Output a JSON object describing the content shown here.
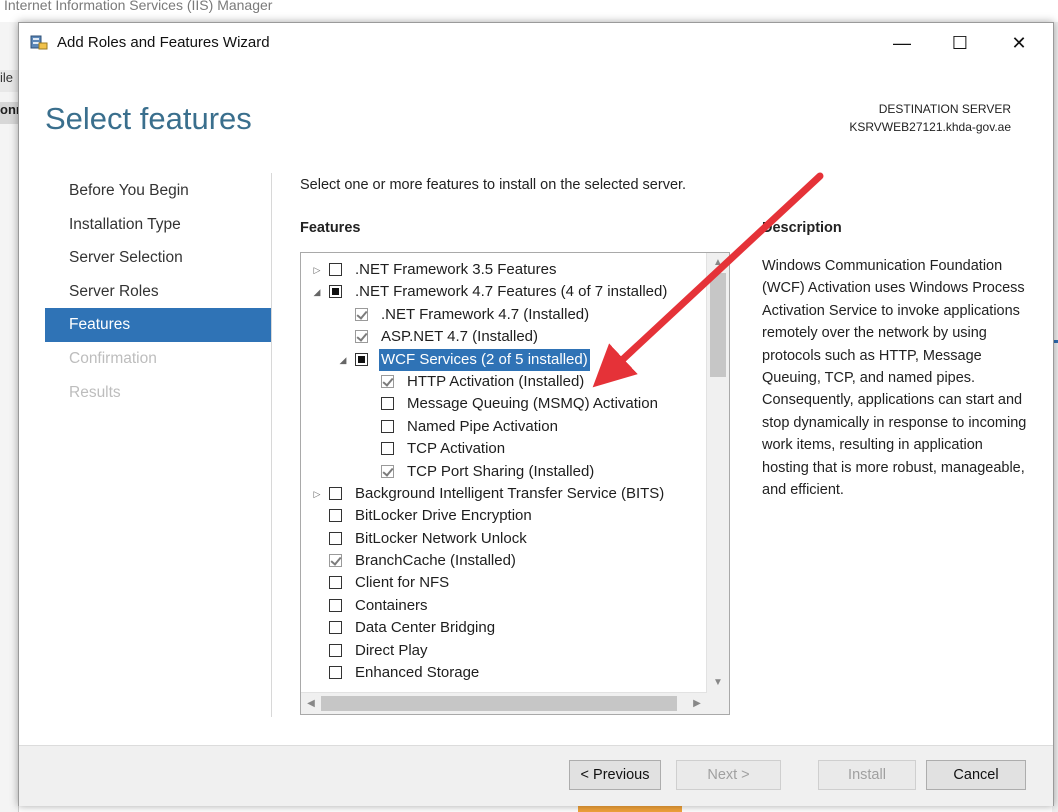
{
  "background_window": {
    "title": "Internet Information Services (IIS) Manager",
    "left_fragments": [
      "ile",
      "onn"
    ]
  },
  "dialog": {
    "title": "Add Roles and Features Wizard",
    "controls": {
      "minimize": "—",
      "maximize": "☐",
      "close": "✕"
    },
    "heading": "Select features",
    "destination_label": "DESTINATION SERVER",
    "destination_server": "KSRVWEB27121.khda-gov.ae"
  },
  "nav": {
    "items": [
      {
        "label": "Before You Begin",
        "state": "normal"
      },
      {
        "label": "Installation Type",
        "state": "normal"
      },
      {
        "label": "Server Selection",
        "state": "normal"
      },
      {
        "label": "Server Roles",
        "state": "normal"
      },
      {
        "label": "Features",
        "state": "active"
      },
      {
        "label": "Confirmation",
        "state": "disabled"
      },
      {
        "label": "Results",
        "state": "disabled"
      }
    ]
  },
  "content": {
    "intro": "Select one or more features to install on the selected server.",
    "features_label": "Features",
    "description_label": "Description",
    "description_text": "Windows Communication Foundation (WCF) Activation uses Windows Process Activation Service to invoke applications remotely over the network by using protocols such as HTTP, Message Queuing, TCP, and named pipes. Consequently, applications can start and stop dynamically in response to incoming work items, resulting in application hosting that is more robust, manageable, and efficient."
  },
  "features": [
    {
      "label": ".NET Framework 3.5 Features",
      "level": 0,
      "expander": "collapsed",
      "state": "unchecked"
    },
    {
      "label": ".NET Framework 4.7 Features (4 of 7 installed)",
      "level": 0,
      "expander": "expanded",
      "state": "partial"
    },
    {
      "label": ".NET Framework 4.7 (Installed)",
      "level": 1,
      "expander": "none",
      "state": "installed"
    },
    {
      "label": "ASP.NET 4.7 (Installed)",
      "level": 1,
      "expander": "none",
      "state": "installed"
    },
    {
      "label": "WCF Services (2 of 5 installed)",
      "level": 1,
      "expander": "expanded",
      "state": "partial",
      "selected": true
    },
    {
      "label": "HTTP Activation (Installed)",
      "level": 2,
      "expander": "none",
      "state": "installed"
    },
    {
      "label": "Message Queuing (MSMQ) Activation",
      "level": 2,
      "expander": "none",
      "state": "unchecked"
    },
    {
      "label": "Named Pipe Activation",
      "level": 2,
      "expander": "none",
      "state": "unchecked"
    },
    {
      "label": "TCP Activation",
      "level": 2,
      "expander": "none",
      "state": "unchecked"
    },
    {
      "label": "TCP Port Sharing (Installed)",
      "level": 2,
      "expander": "none",
      "state": "installed"
    },
    {
      "label": "Background Intelligent Transfer Service (BITS)",
      "level": 0,
      "expander": "collapsed",
      "state": "unchecked"
    },
    {
      "label": "BitLocker Drive Encryption",
      "level": 0,
      "expander": "none",
      "state": "unchecked"
    },
    {
      "label": "BitLocker Network Unlock",
      "level": 0,
      "expander": "none",
      "state": "unchecked"
    },
    {
      "label": "BranchCache (Installed)",
      "level": 0,
      "expander": "none",
      "state": "installed"
    },
    {
      "label": "Client for NFS",
      "level": 0,
      "expander": "none",
      "state": "unchecked"
    },
    {
      "label": "Containers",
      "level": 0,
      "expander": "none",
      "state": "unchecked"
    },
    {
      "label": "Data Center Bridging",
      "level": 0,
      "expander": "none",
      "state": "unchecked"
    },
    {
      "label": "Direct Play",
      "level": 0,
      "expander": "none",
      "state": "unchecked"
    },
    {
      "label": "Enhanced Storage",
      "level": 0,
      "expander": "none",
      "state": "unchecked"
    }
  ],
  "buttons": {
    "previous": "< Previous",
    "next": "Next >",
    "install": "Install",
    "cancel": "Cancel"
  },
  "annotation": {
    "arrow_color": "#e53238",
    "points_to": "HTTP Activation (Installed)"
  },
  "colors": {
    "accent": "#2f73b6",
    "heading": "#3a6f8d"
  }
}
